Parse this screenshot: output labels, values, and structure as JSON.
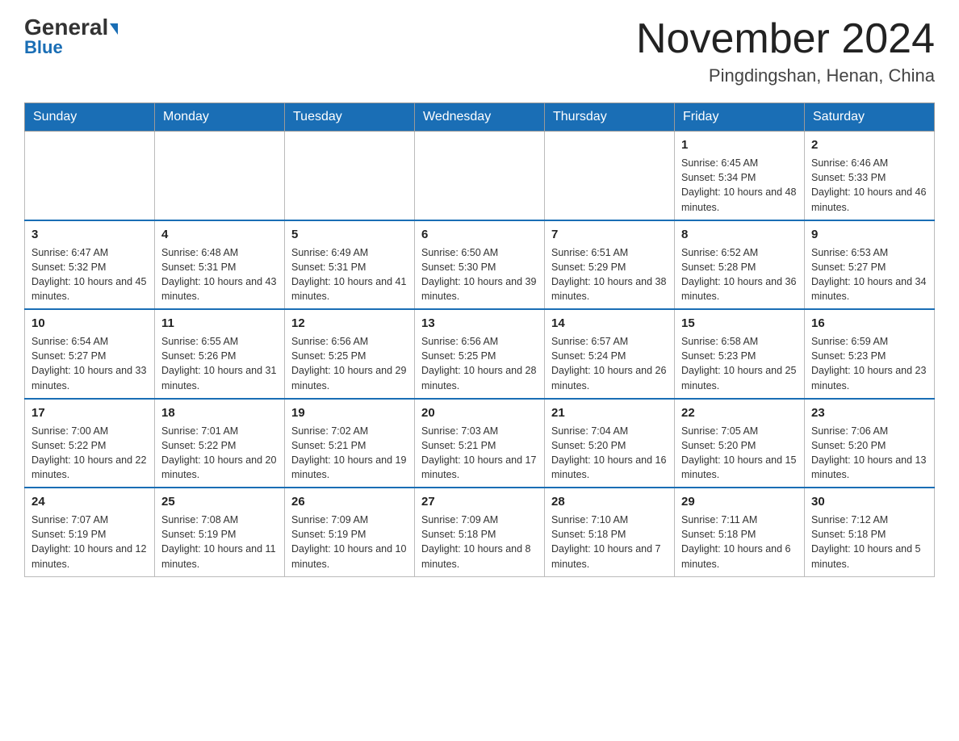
{
  "header": {
    "logo_general": "General",
    "logo_blue": "Blue",
    "title": "November 2024",
    "subtitle": "Pingdingshan, Henan, China"
  },
  "weekdays": [
    "Sunday",
    "Monday",
    "Tuesday",
    "Wednesday",
    "Thursday",
    "Friday",
    "Saturday"
  ],
  "weeks": [
    [
      {
        "day": "",
        "info": ""
      },
      {
        "day": "",
        "info": ""
      },
      {
        "day": "",
        "info": ""
      },
      {
        "day": "",
        "info": ""
      },
      {
        "day": "",
        "info": ""
      },
      {
        "day": "1",
        "info": "Sunrise: 6:45 AM\nSunset: 5:34 PM\nDaylight: 10 hours and 48 minutes."
      },
      {
        "day": "2",
        "info": "Sunrise: 6:46 AM\nSunset: 5:33 PM\nDaylight: 10 hours and 46 minutes."
      }
    ],
    [
      {
        "day": "3",
        "info": "Sunrise: 6:47 AM\nSunset: 5:32 PM\nDaylight: 10 hours and 45 minutes."
      },
      {
        "day": "4",
        "info": "Sunrise: 6:48 AM\nSunset: 5:31 PM\nDaylight: 10 hours and 43 minutes."
      },
      {
        "day": "5",
        "info": "Sunrise: 6:49 AM\nSunset: 5:31 PM\nDaylight: 10 hours and 41 minutes."
      },
      {
        "day": "6",
        "info": "Sunrise: 6:50 AM\nSunset: 5:30 PM\nDaylight: 10 hours and 39 minutes."
      },
      {
        "day": "7",
        "info": "Sunrise: 6:51 AM\nSunset: 5:29 PM\nDaylight: 10 hours and 38 minutes."
      },
      {
        "day": "8",
        "info": "Sunrise: 6:52 AM\nSunset: 5:28 PM\nDaylight: 10 hours and 36 minutes."
      },
      {
        "day": "9",
        "info": "Sunrise: 6:53 AM\nSunset: 5:27 PM\nDaylight: 10 hours and 34 minutes."
      }
    ],
    [
      {
        "day": "10",
        "info": "Sunrise: 6:54 AM\nSunset: 5:27 PM\nDaylight: 10 hours and 33 minutes."
      },
      {
        "day": "11",
        "info": "Sunrise: 6:55 AM\nSunset: 5:26 PM\nDaylight: 10 hours and 31 minutes."
      },
      {
        "day": "12",
        "info": "Sunrise: 6:56 AM\nSunset: 5:25 PM\nDaylight: 10 hours and 29 minutes."
      },
      {
        "day": "13",
        "info": "Sunrise: 6:56 AM\nSunset: 5:25 PM\nDaylight: 10 hours and 28 minutes."
      },
      {
        "day": "14",
        "info": "Sunrise: 6:57 AM\nSunset: 5:24 PM\nDaylight: 10 hours and 26 minutes."
      },
      {
        "day": "15",
        "info": "Sunrise: 6:58 AM\nSunset: 5:23 PM\nDaylight: 10 hours and 25 minutes."
      },
      {
        "day": "16",
        "info": "Sunrise: 6:59 AM\nSunset: 5:23 PM\nDaylight: 10 hours and 23 minutes."
      }
    ],
    [
      {
        "day": "17",
        "info": "Sunrise: 7:00 AM\nSunset: 5:22 PM\nDaylight: 10 hours and 22 minutes."
      },
      {
        "day": "18",
        "info": "Sunrise: 7:01 AM\nSunset: 5:22 PM\nDaylight: 10 hours and 20 minutes."
      },
      {
        "day": "19",
        "info": "Sunrise: 7:02 AM\nSunset: 5:21 PM\nDaylight: 10 hours and 19 minutes."
      },
      {
        "day": "20",
        "info": "Sunrise: 7:03 AM\nSunset: 5:21 PM\nDaylight: 10 hours and 17 minutes."
      },
      {
        "day": "21",
        "info": "Sunrise: 7:04 AM\nSunset: 5:20 PM\nDaylight: 10 hours and 16 minutes."
      },
      {
        "day": "22",
        "info": "Sunrise: 7:05 AM\nSunset: 5:20 PM\nDaylight: 10 hours and 15 minutes."
      },
      {
        "day": "23",
        "info": "Sunrise: 7:06 AM\nSunset: 5:20 PM\nDaylight: 10 hours and 13 minutes."
      }
    ],
    [
      {
        "day": "24",
        "info": "Sunrise: 7:07 AM\nSunset: 5:19 PM\nDaylight: 10 hours and 12 minutes."
      },
      {
        "day": "25",
        "info": "Sunrise: 7:08 AM\nSunset: 5:19 PM\nDaylight: 10 hours and 11 minutes."
      },
      {
        "day": "26",
        "info": "Sunrise: 7:09 AM\nSunset: 5:19 PM\nDaylight: 10 hours and 10 minutes."
      },
      {
        "day": "27",
        "info": "Sunrise: 7:09 AM\nSunset: 5:18 PM\nDaylight: 10 hours and 8 minutes."
      },
      {
        "day": "28",
        "info": "Sunrise: 7:10 AM\nSunset: 5:18 PM\nDaylight: 10 hours and 7 minutes."
      },
      {
        "day": "29",
        "info": "Sunrise: 7:11 AM\nSunset: 5:18 PM\nDaylight: 10 hours and 6 minutes."
      },
      {
        "day": "30",
        "info": "Sunrise: 7:12 AM\nSunset: 5:18 PM\nDaylight: 10 hours and 5 minutes."
      }
    ]
  ]
}
